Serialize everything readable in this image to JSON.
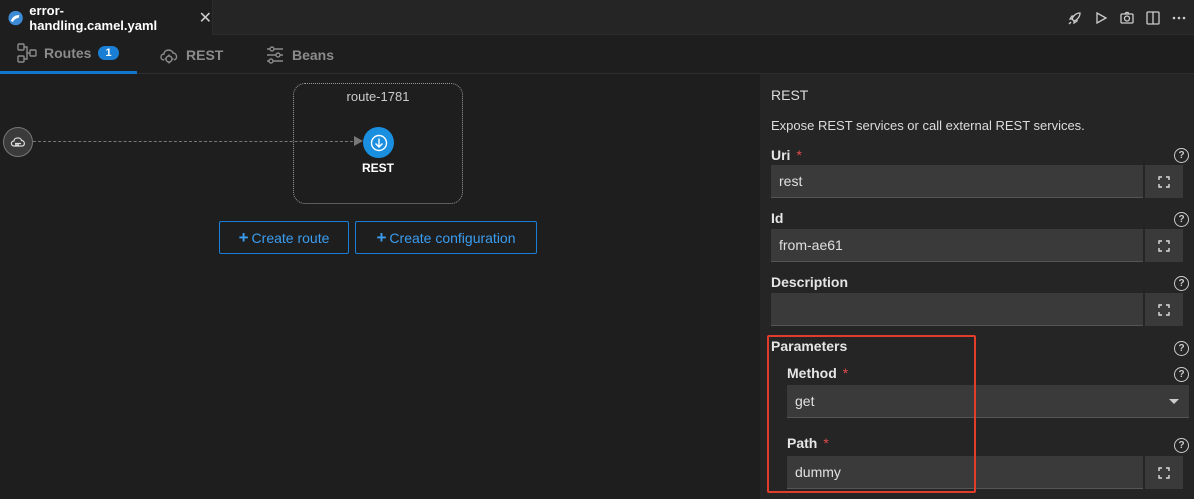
{
  "editor": {
    "tab_title": "error-handling.camel.yaml",
    "close_glyph": "✕",
    "actions": [
      "rocket-icon",
      "run-icon",
      "camera-icon",
      "split-editor-icon",
      "more-icon"
    ]
  },
  "view_tabs": [
    {
      "label": "Routes",
      "badge": "1",
      "icon": "routes-icon",
      "active": true
    },
    {
      "label": "REST",
      "icon": "cloud-gear-icon",
      "active": false
    },
    {
      "label": "Beans",
      "icon": "sliders-icon",
      "active": false
    }
  ],
  "canvas": {
    "route_label": "route-1781",
    "node_label": "REST",
    "create_route": "Create route",
    "create_configuration": "Create configuration",
    "plus": "+"
  },
  "panel": {
    "title": "REST",
    "description": "Expose REST services or call external REST services.",
    "required_mark": "*",
    "help_glyph": "?",
    "fields": {
      "uri": {
        "label": "Uri",
        "value": "rest",
        "required": true
      },
      "id": {
        "label": "Id",
        "value": "from-ae61"
      },
      "description": {
        "label": "Description",
        "value": ""
      },
      "parameters": {
        "label": "Parameters"
      },
      "method": {
        "label": "Method",
        "value": "get",
        "required": true
      },
      "path": {
        "label": "Path",
        "value": "dummy",
        "required": true
      }
    }
  },
  "colors": {
    "accent": "#1a7fd4",
    "highlight": "#e23d2a",
    "required": "#e04b4b"
  }
}
